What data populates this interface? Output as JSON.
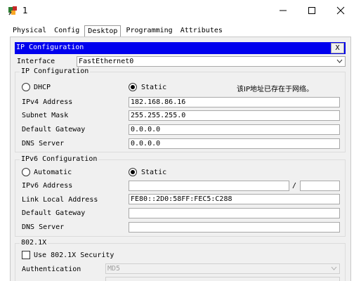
{
  "window": {
    "title": "1",
    "minimize_glyph": "—",
    "maximize_glyph": "☐",
    "close_glyph": "✕",
    "icon": "packet-tracer-pc-icon"
  },
  "tabs": [
    {
      "label": "Physical"
    },
    {
      "label": "Config"
    },
    {
      "label": "Desktop"
    },
    {
      "label": "Programming"
    },
    {
      "label": "Attributes"
    }
  ],
  "active_tab": "Desktop",
  "ip_config": {
    "header_title": "IP Configuration",
    "close_label": "X",
    "interface_label": "Interface",
    "interface_value": "FastEthernet0",
    "ipv4": {
      "group_title": "IP Configuration",
      "dhcp_label": "DHCP",
      "static_label": "Static",
      "mode": "Static",
      "status_message": "该IP地址已存在于网络。",
      "ipv4_address_label": "IPv4 Address",
      "ipv4_address": "182.168.86.16",
      "subnet_mask_label": "Subnet Mask",
      "subnet_mask": "255.255.255.0",
      "default_gateway_label": "Default Gateway",
      "default_gateway": "0.0.0.0",
      "dns_server_label": "DNS Server",
      "dns_server": "0.0.0.0"
    },
    "ipv6": {
      "group_title": "IPv6 Configuration",
      "automatic_label": "Automatic",
      "static_label": "Static",
      "mode": "Static",
      "ipv6_address_label": "IPv6 Address",
      "ipv6_address": "",
      "prefix_separator": "/",
      "prefix_length": "",
      "link_local_label": "Link Local Address",
      "link_local_address": "FE80::2D0:58FF:FEC5:C288",
      "default_gateway_label": "Default Gateway",
      "default_gateway": "",
      "dns_server_label": "DNS Server",
      "dns_server": ""
    },
    "dot1x": {
      "group_title": "802.1X",
      "use_security_label": "Use 802.1X Security",
      "use_security_checked": false,
      "authentication_label": "Authentication",
      "authentication_value": "MD5"
    }
  }
}
